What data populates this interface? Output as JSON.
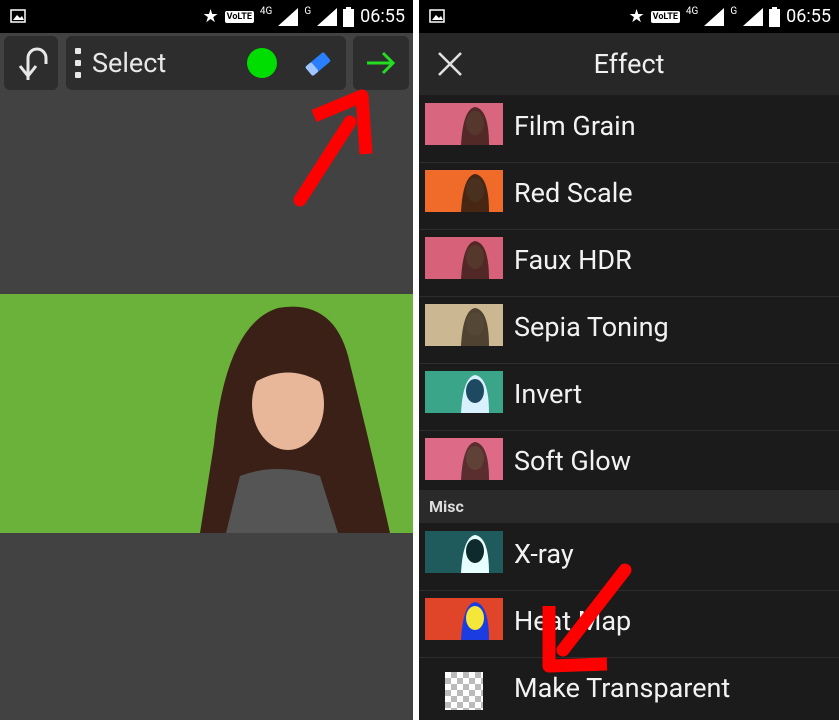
{
  "status_bar": {
    "time": "06:55",
    "volte": "VoLTE",
    "net1": "4G",
    "net2": "G"
  },
  "left_screen": {
    "toolbar": {
      "select_label": "Select"
    },
    "colors": {
      "brush": "#00dd00",
      "eraser": "#2a7fff",
      "next_arrow": "#22dd22"
    }
  },
  "right_screen": {
    "title": "Effect",
    "effects": [
      {
        "label": "Film Grain",
        "thumb_color": "#d9667f"
      },
      {
        "label": "Red Scale",
        "thumb_color": "#f06a2a"
      },
      {
        "label": "Faux HDR",
        "thumb_color": "#d8617a"
      },
      {
        "label": "Sepia Toning",
        "thumb_color": "#cbb791"
      },
      {
        "label": "Invert",
        "thumb_color": "#3aa588"
      },
      {
        "label": "Soft Glow",
        "thumb_color": "#dd6a86"
      }
    ],
    "section_label": "Misc",
    "misc": [
      {
        "label": "X-ray",
        "thumb_color": "#1f5a5c"
      },
      {
        "label": "Heat Map",
        "thumb_color": "#e0452a"
      },
      {
        "label": "Make Transparent"
      }
    ]
  },
  "annotations": {
    "arrow_color": "#ff0000"
  }
}
